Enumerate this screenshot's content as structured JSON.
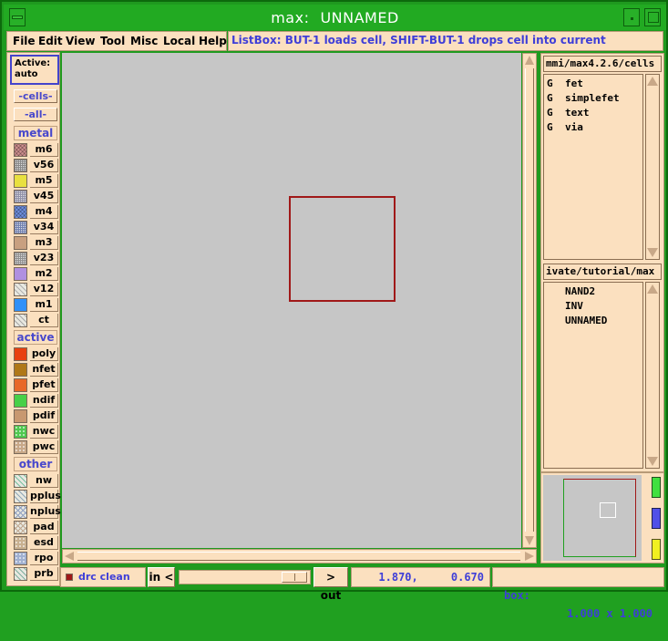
{
  "window": {
    "title": "max:",
    "subtitle": "UNNAMED"
  },
  "menu": {
    "items": [
      "File",
      "Edit",
      "View",
      "Tool",
      "Misc",
      "Local",
      "Help"
    ]
  },
  "status_message": "ListBox: BUT-1 loads cell, SHIFT-BUT-1 drops cell into current",
  "active": {
    "label": "Active:",
    "value": "auto"
  },
  "filters": {
    "cells": "-cells-",
    "all": "-all-"
  },
  "groups": {
    "metal": {
      "label": "metal",
      "layers": [
        {
          "name": "m6",
          "color": "#d09090",
          "pattern": "hatch"
        },
        {
          "name": "v56",
          "color": "#888888",
          "pattern": "grid"
        },
        {
          "name": "m5",
          "color": "#e8e040",
          "pattern": "solid"
        },
        {
          "name": "v45",
          "color": "#9090a8",
          "pattern": "grid"
        },
        {
          "name": "m4",
          "color": "#7090e0",
          "pattern": "hatch"
        },
        {
          "name": "v34",
          "color": "#7080b0",
          "pattern": "grid"
        },
        {
          "name": "m3",
          "color": "#c8a080",
          "pattern": "solid"
        },
        {
          "name": "v23",
          "color": "#909090",
          "pattern": "grid"
        },
        {
          "name": "m2",
          "color": "#b090e0",
          "pattern": "solid"
        },
        {
          "name": "v12",
          "color": "#b0b0b0",
          "pattern": "diag"
        },
        {
          "name": "m1",
          "color": "#3090f8",
          "pattern": "solid"
        },
        {
          "name": "ct",
          "color": "#a8a8a8",
          "pattern": "diag"
        }
      ]
    },
    "active": {
      "label": "active",
      "layers": [
        {
          "name": "poly",
          "color": "#e84010",
          "pattern": "solid"
        },
        {
          "name": "nfet",
          "color": "#b07818",
          "pattern": "solid"
        },
        {
          "name": "pfet",
          "color": "#e86828",
          "pattern": "solid"
        },
        {
          "name": "ndif",
          "color": "#48d048",
          "pattern": "solid"
        },
        {
          "name": "pdif",
          "color": "#c89870",
          "pattern": "solid"
        },
        {
          "name": "nwc",
          "color": "#50c850",
          "pattern": "dots"
        },
        {
          "name": "pwc",
          "color": "#c8a888",
          "pattern": "dots"
        }
      ]
    },
    "other": {
      "label": "other",
      "layers": [
        {
          "name": "nw",
          "color": "#78c0a0",
          "pattern": "diag"
        },
        {
          "name": "pplus",
          "color": "#90a8b8",
          "pattern": "diag"
        },
        {
          "name": "nplus",
          "color": "#90a0c0",
          "pattern": "cross"
        },
        {
          "name": "pad",
          "color": "#c0a890",
          "pattern": "cross"
        },
        {
          "name": "esd",
          "color": "#c8b090",
          "pattern": "dots"
        },
        {
          "name": "rpo",
          "color": "#a0b0d0",
          "pattern": "dots"
        },
        {
          "name": "prb",
          "color": "#80b0a0",
          "pattern": "diag"
        }
      ]
    }
  },
  "cell_library": {
    "path": "mmi/max4.2.6/cells",
    "items": [
      {
        "flag": "G",
        "name": "fet"
      },
      {
        "flag": "G",
        "name": "simplefet"
      },
      {
        "flag": "G",
        "name": "text"
      },
      {
        "flag": "G",
        "name": "via"
      }
    ]
  },
  "current_dir": {
    "path": "ivate/tutorial/max",
    "items": [
      "NAND2",
      "INV",
      "UNNAMED"
    ]
  },
  "bottom": {
    "drc": "drc clean",
    "zoom_in": "in <",
    "zoom_out": "> out",
    "coords": "1.870,     0.670",
    "box_label": "box:",
    "box_value": "1.000 x 1.000"
  },
  "colors": {
    "frame": "#1f9a1f",
    "panel": "#fbe0bf",
    "accent": "#4848cc",
    "canvas": "#c6c6c6",
    "cell_box": "#a01818"
  }
}
